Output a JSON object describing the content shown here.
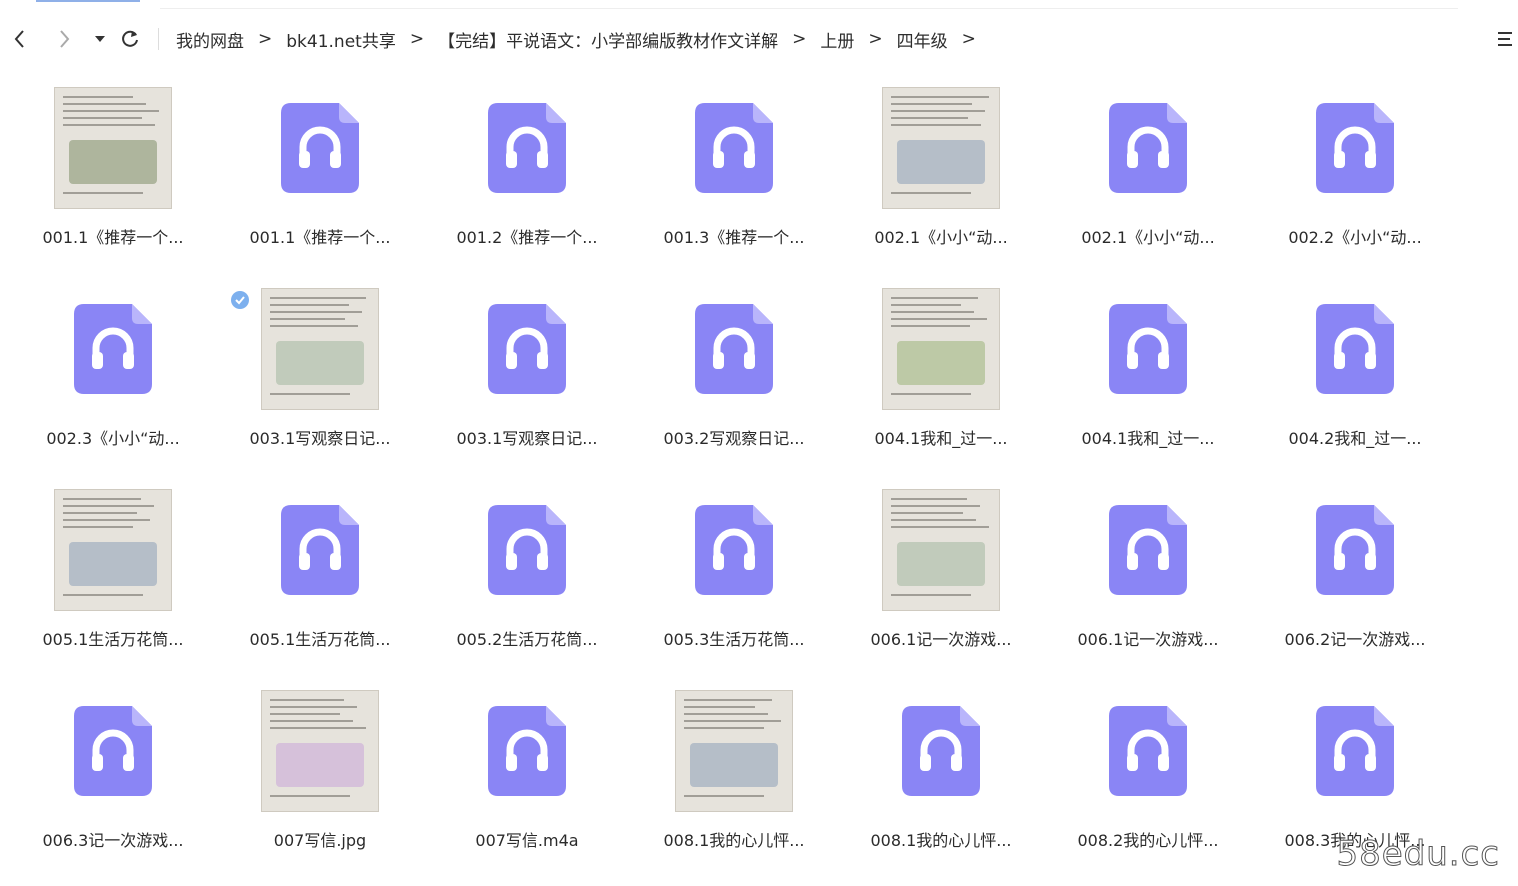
{
  "breadcrumb": [
    {
      "label": "我的网盘"
    },
    {
      "label": "bk41.net共享"
    },
    {
      "label": "【完结】平说语文：小学部编版教材作文详解"
    },
    {
      "label": "上册"
    },
    {
      "label": "四年级"
    }
  ],
  "separator": ">",
  "colors": {
    "audio_icon": "#8a85f5",
    "audio_icon_fold": "#b9b5fb",
    "text": "#2b2b2b"
  },
  "files": [
    {
      "name": "001.1《推荐一个...",
      "kind": "image",
      "icon": "photo-thumbnail"
    },
    {
      "name": "001.1《推荐一个...",
      "kind": "audio",
      "icon": "audio-file-icon"
    },
    {
      "name": "001.2《推荐一个...",
      "kind": "audio",
      "icon": "audio-file-icon"
    },
    {
      "name": "001.3《推荐一个...",
      "kind": "audio",
      "icon": "audio-file-icon"
    },
    {
      "name": "002.1《小小“动...",
      "kind": "image",
      "icon": "photo-thumbnail"
    },
    {
      "name": "002.1《小小“动...",
      "kind": "audio",
      "icon": "audio-file-icon"
    },
    {
      "name": "002.2《小小“动...",
      "kind": "audio",
      "icon": "audio-file-icon"
    },
    {
      "name": "002.3《小小“动...",
      "kind": "audio",
      "icon": "audio-file-icon"
    },
    {
      "name": "003.1写观察日记...",
      "kind": "image",
      "icon": "photo-thumbnail",
      "selected": true
    },
    {
      "name": "003.1写观察日记...",
      "kind": "audio",
      "icon": "audio-file-icon"
    },
    {
      "name": "003.2写观察日记...",
      "kind": "audio",
      "icon": "audio-file-icon"
    },
    {
      "name": "004.1我和_过一...",
      "kind": "image",
      "icon": "photo-thumbnail"
    },
    {
      "name": "004.1我和_过一...",
      "kind": "audio",
      "icon": "audio-file-icon"
    },
    {
      "name": "004.2我和_过一...",
      "kind": "audio",
      "icon": "audio-file-icon"
    },
    {
      "name": "005.1生活万花筒...",
      "kind": "image",
      "icon": "photo-thumbnail"
    },
    {
      "name": "005.1生活万花筒...",
      "kind": "audio",
      "icon": "audio-file-icon"
    },
    {
      "name": "005.2生活万花筒...",
      "kind": "audio",
      "icon": "audio-file-icon"
    },
    {
      "name": "005.3生活万花筒...",
      "kind": "audio",
      "icon": "audio-file-icon"
    },
    {
      "name": "006.1记一次游戏...",
      "kind": "image",
      "icon": "photo-thumbnail"
    },
    {
      "name": "006.1记一次游戏...",
      "kind": "audio",
      "icon": "audio-file-icon"
    },
    {
      "name": "006.2记一次游戏...",
      "kind": "audio",
      "icon": "audio-file-icon"
    },
    {
      "name": "006.3记一次游戏...",
      "kind": "audio",
      "icon": "audio-file-icon"
    },
    {
      "name": "007写信.jpg",
      "kind": "image",
      "icon": "photo-thumbnail"
    },
    {
      "name": "007写信.m4a",
      "kind": "audio",
      "icon": "audio-file-icon"
    },
    {
      "name": "008.1我的心儿怦...",
      "kind": "image",
      "icon": "photo-thumbnail"
    },
    {
      "name": "008.1我的心儿怦...",
      "kind": "audio",
      "icon": "audio-file-icon"
    },
    {
      "name": "008.2我的心儿怦...",
      "kind": "audio",
      "icon": "audio-file-icon"
    },
    {
      "name": "008.3我的心儿怦...",
      "kind": "audio",
      "icon": "audio-file-icon"
    }
  ],
  "watermark": "58edu.cc"
}
